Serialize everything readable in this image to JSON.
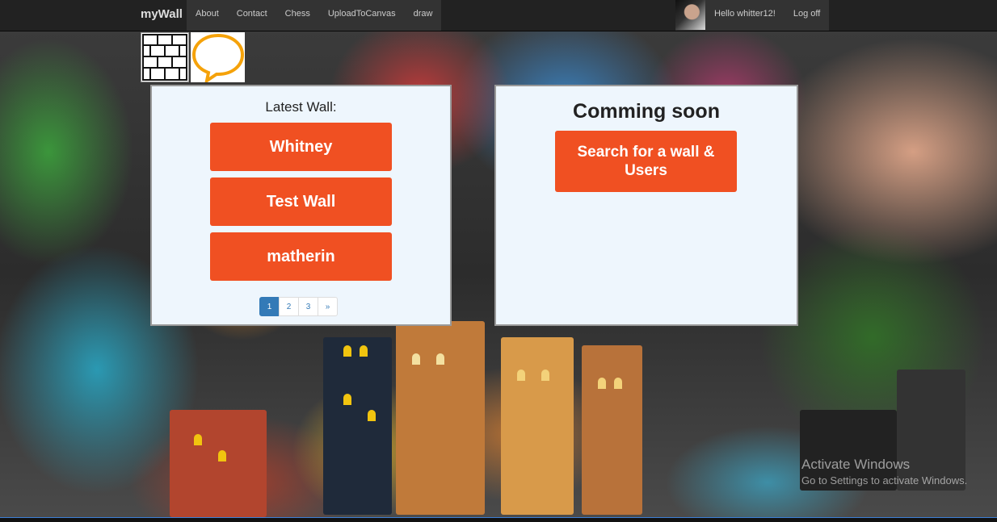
{
  "navbar": {
    "brand": "myWall",
    "links": [
      "About",
      "Contact",
      "Chess",
      "UploadToCanvas",
      "draw"
    ],
    "greeting": "Hello whitter12!",
    "logoff": "Log off"
  },
  "latest": {
    "title": "Latest Wall:",
    "walls": [
      "Whitney",
      "Test Wall",
      "matherin"
    ]
  },
  "pagination": {
    "pages": [
      "1",
      "2",
      "3",
      "»"
    ],
    "active": "1"
  },
  "coming": {
    "title": "Comming soon",
    "search_label": "Search for a wall & Users"
  },
  "watermark": {
    "line1": "Activate Windows",
    "line2": "Go to Settings to activate Windows."
  },
  "colors": {
    "accent": "#f05022",
    "panel_bg": "#eef6fd",
    "navbar_bg": "#222222",
    "pager_active": "#337ab7"
  },
  "icons": {
    "wall_logo": "brick-wall-icon",
    "chat_logo": "speech-bubble-icon"
  }
}
